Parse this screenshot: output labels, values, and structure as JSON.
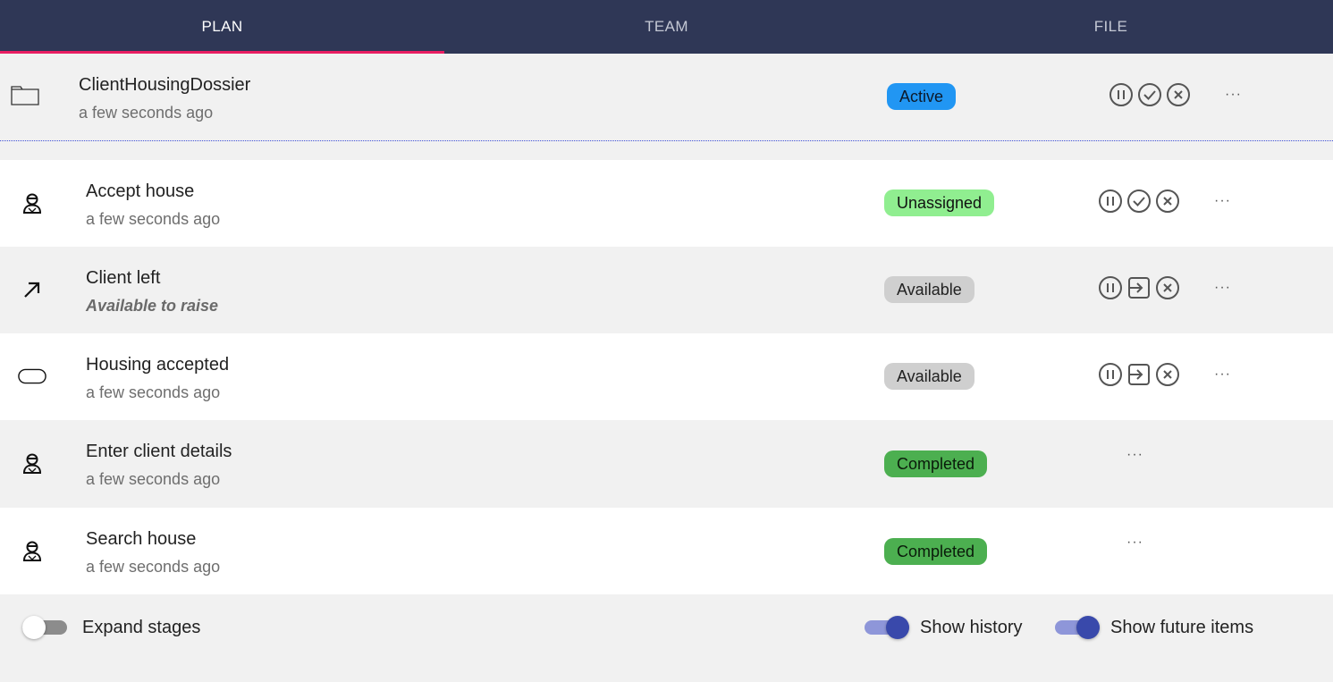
{
  "tabs": [
    {
      "label": "PLAN",
      "active": true
    },
    {
      "label": "TEAM",
      "active": false
    },
    {
      "label": "FILE",
      "active": false
    }
  ],
  "case": {
    "icon": "folder-icon",
    "title": "ClientHousingDossier",
    "subtitle": "a few seconds ago",
    "status": "Active",
    "more": "···"
  },
  "items": [
    {
      "icon": "human-task-icon",
      "title": "Accept house",
      "subtitle": "a few seconds ago",
      "status": "Unassigned",
      "more": "···"
    },
    {
      "icon": "user-event-arrow-icon",
      "title": "Client left",
      "subtitle": "Available to raise",
      "status": "Available",
      "more": "···"
    },
    {
      "icon": "milestone-icon",
      "title": "Housing accepted",
      "subtitle": "a few seconds ago",
      "status": "Available",
      "more": "···"
    },
    {
      "icon": "human-task-icon",
      "title": "Enter client details",
      "subtitle": "a few seconds ago",
      "status": "Completed",
      "more": "···"
    },
    {
      "icon": "human-task-icon",
      "title": "Search house",
      "subtitle": "a few seconds ago",
      "status": "Completed",
      "more": "···"
    }
  ],
  "footer": {
    "expand_stages": {
      "label": "Expand stages",
      "on": false
    },
    "show_history": {
      "label": "Show history",
      "on": true
    },
    "show_future": {
      "label": "Show future items",
      "on": true
    }
  },
  "colors": {
    "header_bg": "#2f3756",
    "tab_indicator": "#e91e63",
    "active_badge": "#2196f3",
    "unassigned_badge": "#90ee90",
    "available_badge": "#cfcfcf",
    "completed_badge": "#4caf50",
    "toggle_on": "#3949ab"
  }
}
